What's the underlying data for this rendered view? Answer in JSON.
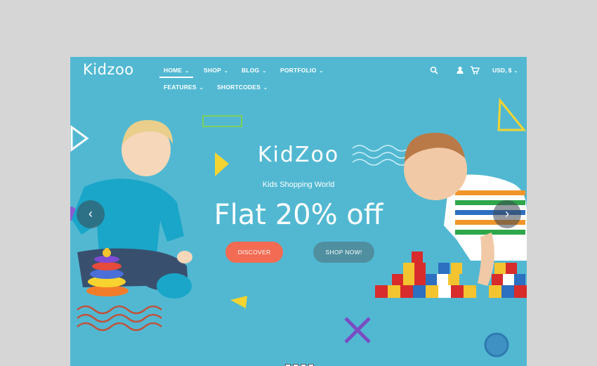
{
  "header": {
    "logo": "Kidzoo",
    "nav": [
      {
        "label": "HOME"
      },
      {
        "label": "SHOP"
      },
      {
        "label": "BLOG"
      },
      {
        "label": "PORTFOLIO"
      },
      {
        "label": "FEATURES"
      },
      {
        "label": "SHORTCODES"
      }
    ],
    "currency": "USD, $"
  },
  "hero": {
    "brand": "KidZoo",
    "tagline": "Kids Shopping World",
    "headline": "Flat 20% off",
    "discover_label": "DISCOVER",
    "shop_label": "SHOP NOW!"
  },
  "icons": {
    "search": "search-icon",
    "user": "user-icon",
    "cart": "cart-icon",
    "chevron": "chevron-down-icon"
  },
  "colors": {
    "hero_background": "#52b8d2",
    "discover_button": "#f26b52",
    "shop_button": "#4f8fa0",
    "page_background": "#d6d6d6"
  },
  "slider": {
    "dot_count": 4
  }
}
